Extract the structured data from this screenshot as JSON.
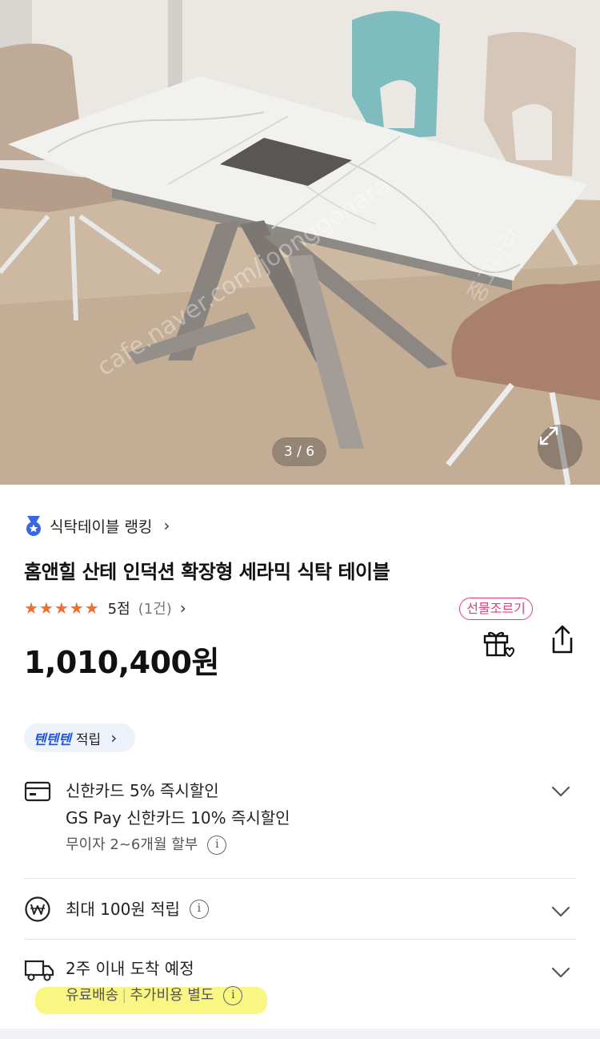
{
  "gallery": {
    "counter": "3 / 6",
    "watermark_1": "cafe.naver.com/joonggonara",
    "watermark_2": "joonggonara",
    "watermark_3": "중고나라"
  },
  "rank": {
    "label": "식탁테이블 랭킹"
  },
  "product": {
    "title": "홈앤힐 산테 인덕션 확장형 세라믹 식탁 테이블",
    "stars": "★★★★★",
    "score": "5점",
    "review_count": "(1건)",
    "price": "1,010,400원"
  },
  "actions": {
    "gift_label": "선물조르기"
  },
  "points_chip": {
    "brand": "텐텐텐",
    "label": "적립"
  },
  "card_benefit": {
    "line1": "신한카드 5% 즉시할인",
    "line2": "GS Pay 신한카드 10% 즉시할인",
    "installment": "무이자 2~6개월 할부"
  },
  "reward": {
    "label": "최대 100원 적립"
  },
  "delivery": {
    "eta": "2주 이내 도착 예정",
    "fee_type": "유료배송",
    "fee_note": "추가비용 별도"
  },
  "colors": {
    "star": "#ef6f2e",
    "gift_accent": "#e63a7a",
    "point_brand": "#1f55e6",
    "highlight": "#f8f46e"
  }
}
